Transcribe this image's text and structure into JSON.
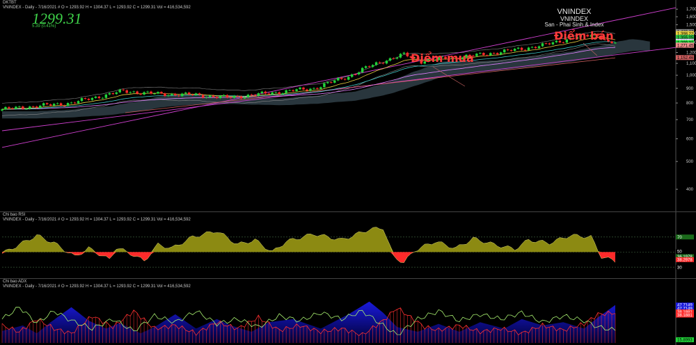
{
  "window": {
    "title": "DKTBT"
  },
  "price_pane": {
    "header": "VNINDEX - Daily - 7/16/2021  #  O = 1293.92  H = 1304.37  L = 1293.92  C = 1299.31  Vol = 416,534,592",
    "last_price": "1299.31",
    "change": "5.39  (0.41%)",
    "watermark": {
      "line1": "VNINDEX",
      "line2": "VNINDEX",
      "line3": "San - Phai Sinh & Index"
    },
    "annotations": {
      "buy": "Điểm mua",
      "sell": "Điểm bán"
    }
  },
  "rsi_pane": {
    "title": "Chi bao RSI",
    "header": "VNINDEX - Daily - 7/16/2021  #  O = 1293.92  H = 1304.37  L = 1293.92  C = 1299.31  Vol = 416,534,592"
  },
  "adx_pane": {
    "title": "Chi bao ADX",
    "header": "VNINDEX - Daily - 7/16/2021  #  O = 1293.92  H = 1304.37  L = 1293.92  C = 1299.31  Vol = 416,534,592"
  },
  "colors": {
    "up": "#22d43a",
    "down": "#ff2a2a",
    "channel": "#d040d0",
    "cloud": "#4a6270",
    "rsi_fill": "#8c8a12",
    "adx_fill": "#1a1adc",
    "di_plus": "#a8f070",
    "di_minus": "#ff3030"
  },
  "chart_data": [
    {
      "type": "line",
      "name": "price",
      "yticks": [
        "1,700",
        "1,600",
        "1,500",
        "1,400",
        "1,300",
        "1,200",
        "1,100",
        "1,000",
        "900",
        "800",
        "700",
        "600",
        "500",
        "400"
      ],
      "ylim": [
        350,
        1750
      ],
      "scale": "log",
      "n": 178,
      "close_anchors": [
        [
          0,
          760
        ],
        [
          20,
          800
        ],
        [
          35,
          880
        ],
        [
          45,
          860
        ],
        [
          55,
          855
        ],
        [
          65,
          835
        ],
        [
          75,
          860
        ],
        [
          90,
          900
        ],
        [
          100,
          990
        ],
        [
          105,
          1060
        ],
        [
          110,
          1120
        ],
        [
          116,
          1180
        ],
        [
          121,
          1120
        ],
        [
          126,
          1140
        ],
        [
          136,
          1170
        ],
        [
          146,
          1215
        ],
        [
          156,
          1270
        ],
        [
          166,
          1360
        ],
        [
          172,
          1390
        ],
        [
          175,
          1300
        ],
        [
          177,
          1299.31
        ]
      ],
      "right_labels": [
        {
          "text": "1,420.27",
          "value": 1420.27,
          "bg": "#8a8a8a",
          "fg": "#000000"
        },
        {
          "text": "1,398.22",
          "value": 1398.22,
          "bg": "#e8d040",
          "fg": "#000000"
        },
        {
          "text": "1,355.12",
          "value": 1355.12,
          "bg": "#40c0c0",
          "fg": "#000000"
        },
        {
          "text": "1,355.05",
          "value": 1355.05,
          "bg": "#2cc040",
          "fg": "#000000"
        },
        {
          "text": "1,313.82",
          "value": 1313.82,
          "bg": "#c080ff",
          "fg": "#000000"
        },
        {
          "text": "1,309.17",
          "value": 1309.17,
          "bg": "#ffffff",
          "fg": "#000000"
        },
        {
          "text": "1,299.31",
          "value": 1299.31,
          "bg": "#22d43a",
          "fg": "#000000"
        },
        {
          "text": "1,273.85",
          "value": 1273.85,
          "bg": "#f0c0c0",
          "fg": "#000000"
        },
        {
          "text": "1,271.45",
          "value": 1271.45,
          "bg": "#f08a8a",
          "fg": "#000000"
        },
        {
          "text": "1,152.46",
          "value": 1152.46,
          "bg": "#d06060",
          "fg": "#000000"
        }
      ]
    },
    {
      "type": "area",
      "name": "RSI",
      "ylim": [
        20,
        90
      ],
      "yticks": [
        "70",
        "50",
        "30"
      ],
      "levels": [
        70,
        50,
        30
      ],
      "anchors": [
        [
          0,
          48
        ],
        [
          5,
          60
        ],
        [
          10,
          72
        ],
        [
          15,
          62
        ],
        [
          21,
          44
        ],
        [
          25,
          55
        ],
        [
          31,
          40
        ],
        [
          33,
          56
        ],
        [
          38,
          46
        ],
        [
          41,
          38
        ],
        [
          45,
          60
        ],
        [
          49,
          55
        ],
        [
          55,
          70
        ],
        [
          62,
          78
        ],
        [
          68,
          60
        ],
        [
          73,
          66
        ],
        [
          78,
          50
        ],
        [
          82,
          64
        ],
        [
          90,
          74
        ],
        [
          98,
          66
        ],
        [
          106,
          80
        ],
        [
          110,
          82
        ],
        [
          113,
          44
        ],
        [
          116,
          36
        ],
        [
          119,
          52
        ],
        [
          125,
          64
        ],
        [
          131,
          55
        ],
        [
          136,
          68
        ],
        [
          142,
          60
        ],
        [
          148,
          54
        ],
        [
          152,
          66
        ],
        [
          158,
          62
        ],
        [
          164,
          72
        ],
        [
          170,
          70
        ],
        [
          173,
          44
        ],
        [
          177,
          38
        ]
      ],
      "right_labels": [
        {
          "text": "70",
          "value": 70,
          "bg": "#1a6a1a",
          "fg": "#ffffff"
        },
        {
          "text": "50",
          "value": 51,
          "bg": "#000000",
          "fg": "#ffffff"
        },
        {
          "text": "36.1978",
          "value": 44,
          "bg": "#1a6a1a",
          "fg": "#ffffff"
        },
        {
          "text": "38.2978",
          "value": 40,
          "bg": "#ff2a2a",
          "fg": "#ffffff"
        },
        {
          "text": "30",
          "value": 30,
          "bg": "#000000",
          "fg": "#ffffff"
        }
      ]
    },
    {
      "type": "area",
      "name": "ADX",
      "ylim": [
        0,
        70
      ],
      "yticks": [],
      "adx_anchors": [
        [
          0,
          15
        ],
        [
          6,
          22
        ],
        [
          10,
          12
        ],
        [
          14,
          26
        ],
        [
          20,
          45
        ],
        [
          25,
          28
        ],
        [
          30,
          18
        ],
        [
          34,
          25
        ],
        [
          40,
          12
        ],
        [
          44,
          20
        ],
        [
          50,
          36
        ],
        [
          56,
          18
        ],
        [
          62,
          30
        ],
        [
          66,
          22
        ],
        [
          72,
          14
        ],
        [
          77,
          26
        ],
        [
          84,
          30
        ],
        [
          92,
          18
        ],
        [
          100,
          36
        ],
        [
          106,
          52
        ],
        [
          110,
          38
        ],
        [
          114,
          20
        ],
        [
          120,
          14
        ],
        [
          126,
          24
        ],
        [
          132,
          14
        ],
        [
          138,
          26
        ],
        [
          145,
          18
        ],
        [
          150,
          30
        ],
        [
          156,
          22
        ],
        [
          162,
          26
        ],
        [
          168,
          18
        ],
        [
          172,
          32
        ],
        [
          177,
          47.7
        ]
      ],
      "di_plus_anchors": [
        [
          0,
          30
        ],
        [
          5,
          45
        ],
        [
          10,
          25
        ],
        [
          15,
          40
        ],
        [
          20,
          28
        ],
        [
          26,
          18
        ],
        [
          32,
          30
        ],
        [
          38,
          15
        ],
        [
          44,
          34
        ],
        [
          50,
          26
        ],
        [
          56,
          40
        ],
        [
          62,
          24
        ],
        [
          68,
          30
        ],
        [
          74,
          20
        ],
        [
          80,
          34
        ],
        [
          86,
          28
        ],
        [
          92,
          38
        ],
        [
          98,
          30
        ],
        [
          104,
          40
        ],
        [
          110,
          22
        ],
        [
          114,
          10
        ],
        [
          120,
          30
        ],
        [
          126,
          40
        ],
        [
          132,
          28
        ],
        [
          138,
          36
        ],
        [
          144,
          30
        ],
        [
          150,
          38
        ],
        [
          156,
          26
        ],
        [
          162,
          34
        ],
        [
          168,
          28
        ],
        [
          172,
          20
        ],
        [
          177,
          16
        ]
      ],
      "di_minus_anchors": [
        [
          0,
          22
        ],
        [
          5,
          14
        ],
        [
          10,
          30
        ],
        [
          15,
          18
        ],
        [
          20,
          12
        ],
        [
          26,
          34
        ],
        [
          32,
          20
        ],
        [
          38,
          40
        ],
        [
          44,
          18
        ],
        [
          50,
          22
        ],
        [
          56,
          12
        ],
        [
          62,
          26
        ],
        [
          68,
          18
        ],
        [
          74,
          32
        ],
        [
          80,
          16
        ],
        [
          86,
          22
        ],
        [
          92,
          14
        ],
        [
          98,
          18
        ],
        [
          104,
          10
        ],
        [
          110,
          28
        ],
        [
          114,
          44
        ],
        [
          118,
          32
        ],
        [
          122,
          20
        ],
        [
          126,
          16
        ],
        [
          132,
          22
        ],
        [
          138,
          14
        ],
        [
          144,
          18
        ],
        [
          150,
          12
        ],
        [
          156,
          22
        ],
        [
          162,
          16
        ],
        [
          168,
          24
        ],
        [
          172,
          36
        ],
        [
          177,
          38
        ]
      ],
      "right_labels": [
        {
          "text": "47.7149",
          "value": 47.7,
          "bg": "#1a1adc",
          "fg": "#ffffff"
        },
        {
          "text": "47.7149",
          "value": 43.5,
          "bg": "#1a1adc",
          "fg": "#ffffff"
        },
        {
          "text": "38.1881",
          "value": 39,
          "bg": "#ff2a2a",
          "fg": "#ffffff"
        },
        {
          "text": "38.1881",
          "value": 35,
          "bg": "#ff2a2a",
          "fg": "#ffffff"
        },
        {
          "text": "15.8993",
          "value": 4,
          "bg": "#22d43a",
          "fg": "#000000"
        }
      ]
    }
  ]
}
